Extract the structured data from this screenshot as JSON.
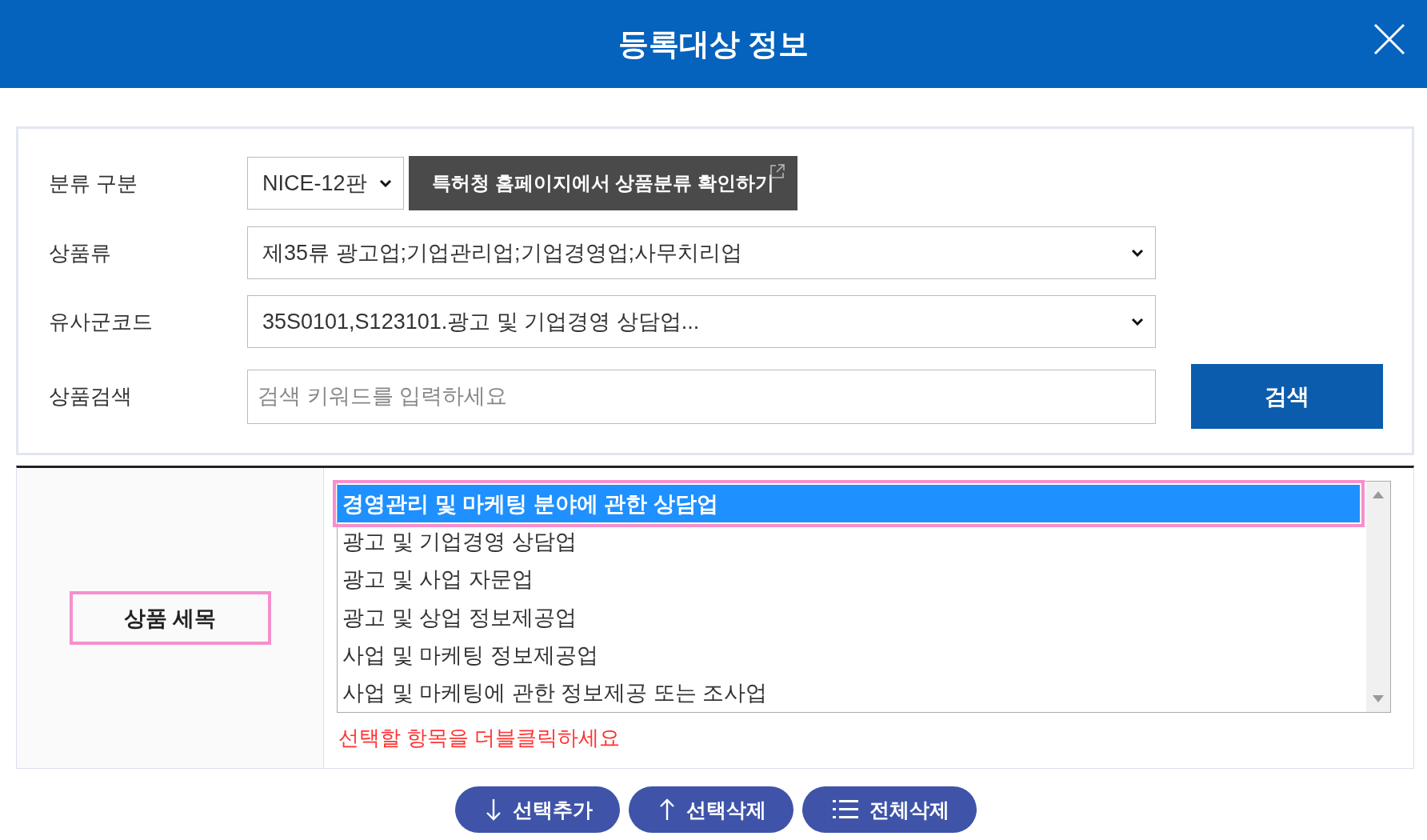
{
  "dialog": {
    "title": "등록대상 정보"
  },
  "form": {
    "rows": [
      {
        "kind": "edition",
        "label": "분류 구분",
        "value": "NICE-12판",
        "link": "특허청 홈페이지에서 상품분류 확인하기"
      },
      {
        "kind": "select",
        "label": "상품류",
        "value": "제35류 광고업;기업관리업;기업경영업;사무치리업"
      },
      {
        "kind": "select",
        "label": "유사군코드",
        "value": "35S0101,S123101.광고 및 기업경영 상담업..."
      },
      {
        "kind": "search",
        "label": "상품검색",
        "placeholder": "검색 키워드를 입력하세요",
        "button": "검색"
      }
    ]
  },
  "details": {
    "label": "상품 세목",
    "label_highlighted": true,
    "options": [
      {
        "text": "경영관리 및 마케팅 분야에 관한 상담업",
        "selected": true,
        "highlighted": true
      },
      {
        "text": "광고 및 기업경영 상담업",
        "selected": false,
        "highlighted": false
      },
      {
        "text": "광고 및 사업 자문업",
        "selected": false,
        "highlighted": false
      },
      {
        "text": "광고 및 상업 정보제공업",
        "selected": false,
        "highlighted": false
      },
      {
        "text": "사업 및 마케팅 정보제공업",
        "selected": false,
        "highlighted": false
      },
      {
        "text": "사업 및 마케팅에 관한 정보제공 또는 조사업",
        "selected": false,
        "highlighted": false
      }
    ],
    "hint": "선택할 항목을 더블클릭하세요"
  },
  "actions": [
    {
      "kind": "add",
      "label": "선택추가"
    },
    {
      "kind": "remove",
      "label": "선택삭제"
    },
    {
      "kind": "clear",
      "label": "전체삭제"
    }
  ]
}
